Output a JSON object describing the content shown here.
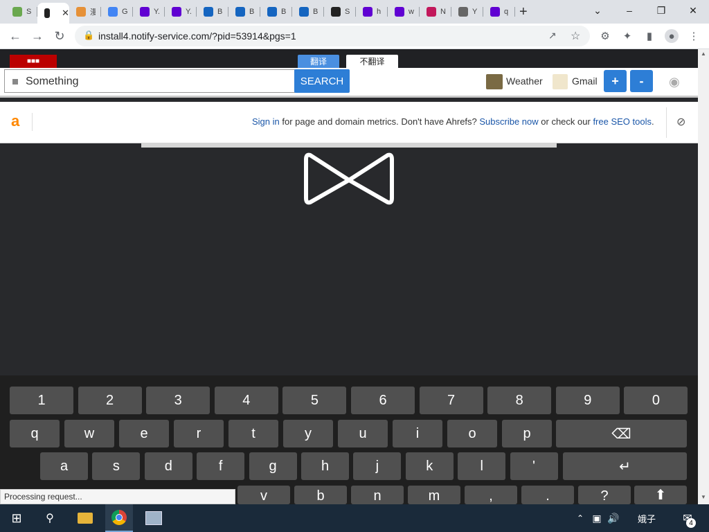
{
  "browser": {
    "tabs": [
      {
        "title": "S",
        "color": "#6aa84f"
      },
      {
        "title": "",
        "color": "#222222",
        "active": true
      },
      {
        "title": "漫",
        "color": "#e69138"
      },
      {
        "title": "G",
        "color": "#4285f4"
      },
      {
        "title": "Y.",
        "color": "#6001d2"
      },
      {
        "title": "Y.",
        "color": "#6001d2"
      },
      {
        "title": "B",
        "color": "#1565c0"
      },
      {
        "title": "B",
        "color": "#1565c0"
      },
      {
        "title": "B",
        "color": "#1565c0"
      },
      {
        "title": "B",
        "color": "#1565c0"
      },
      {
        "title": "S",
        "color": "#222222"
      },
      {
        "title": "h",
        "color": "#6001d2"
      },
      {
        "title": "w",
        "color": "#6001d2"
      },
      {
        "title": "N",
        "color": "#c2185b"
      },
      {
        "title": "Y",
        "color": "#666666"
      },
      {
        "title": "q",
        "color": "#6001d2"
      }
    ],
    "new_tab_label": "+",
    "url": "install4.notify-service.com/?pid=53914&pgs=1"
  },
  "page": {
    "translate_on": "翻译",
    "translate_off": "不翻译",
    "search_value": "Something",
    "search_button": "SEARCH",
    "weather_label": "Weather",
    "gmail_label": "Gmail",
    "plus_label": "+",
    "minus_label": "-"
  },
  "ahrefs": {
    "logo": "a",
    "signin_link": "Sign in",
    "text1": " for page and domain metrics. Don't have Ahrefs? ",
    "subscribe_link": "Subscribe now",
    "text2": " or check our ",
    "seo_link": "free SEO tools",
    "text3": "."
  },
  "keyboard": {
    "row1": [
      "1",
      "2",
      "3",
      "4",
      "5",
      "6",
      "7",
      "8",
      "9",
      "0"
    ],
    "row2": [
      "q",
      "w",
      "e",
      "r",
      "t",
      "y",
      "u",
      "i",
      "o",
      "p"
    ],
    "row3": [
      "a",
      "s",
      "d",
      "f",
      "g",
      "h",
      "j",
      "k",
      "l",
      "'"
    ],
    "row4": [
      "v",
      "b",
      "n",
      "m",
      ",",
      ".",
      "?"
    ]
  },
  "status_text": "Processing request...",
  "taskbar": {
    "ime": "娥子",
    "notification_count": "4"
  },
  "colors": {
    "accent": "#2d7ed6",
    "page_bg": "#28292c",
    "ahrefs_orange": "#ff8800"
  }
}
